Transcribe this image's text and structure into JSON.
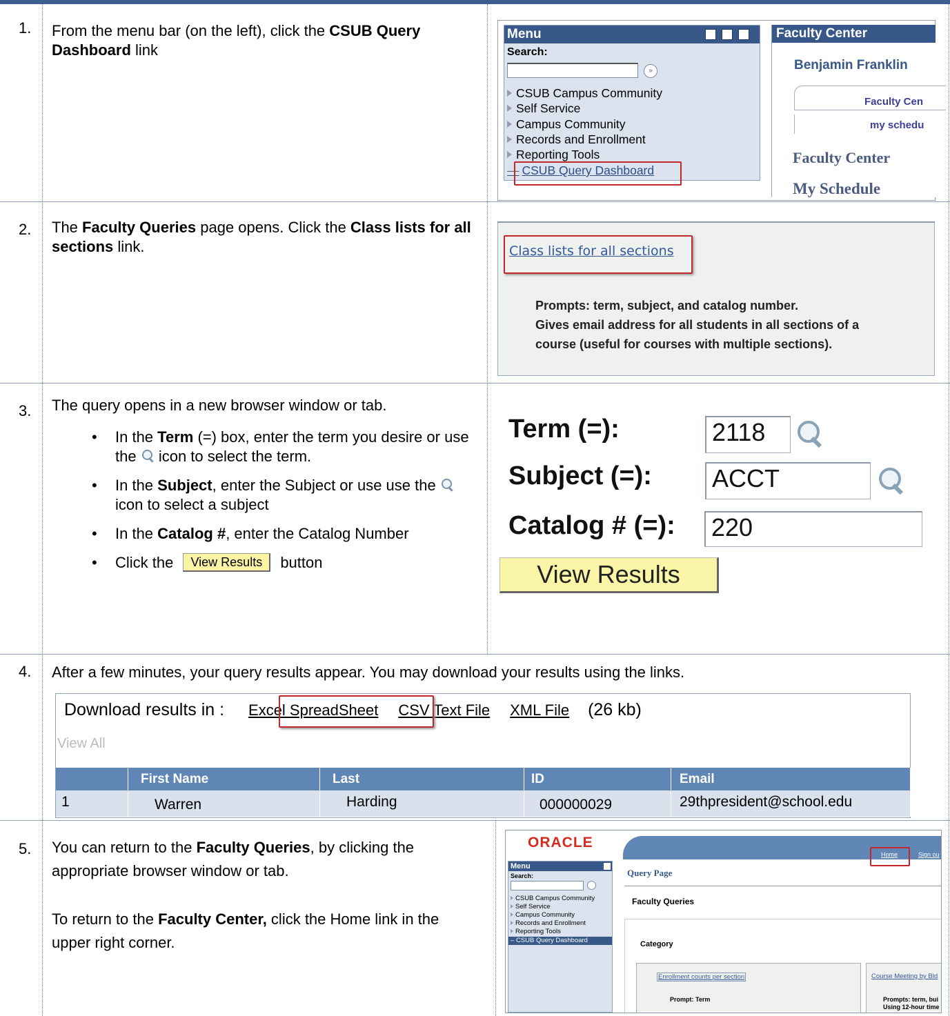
{
  "steps": [
    {
      "num": "1."
    },
    {
      "num": "2."
    },
    {
      "num": "3."
    },
    {
      "num": "4."
    },
    {
      "num": "5."
    }
  ],
  "step1": {
    "text_before": "From the menu bar (on the left), click the ",
    "bold": "CSUB Query Dashboard",
    "text_after": " link",
    "menu": {
      "title": "Menu",
      "search_label": "Search:",
      "items": [
        "CSUB Campus Community",
        "Self Service",
        "Campus Community",
        "Records and Enrollment",
        "Reporting Tools",
        "CSUB Query Dashboard"
      ]
    },
    "faculty": {
      "title": "Faculty Center",
      "name": "Benjamin Franklin",
      "tab1": "Faculty Cen",
      "tab2": "my schedu",
      "heading1": "Faculty Center",
      "heading2": "My Schedule"
    }
  },
  "step2": {
    "t1": "The ",
    "b1": "Faculty Queries",
    "t2": " page opens. Click the ",
    "b2": "Class lists for all sections",
    "t3": " link.",
    "link": "Class lists for all sections",
    "prompt1": "Prompts: term, subject, and catalog number.",
    "prompt2": "Gives email address for all students in all sections of a",
    "prompt3": "course (useful for courses with multiple sections)."
  },
  "step3": {
    "intro": "The query opens in a new browser window or tab.",
    "b1a": "In the ",
    "b1b": "Term",
    "b1c": " (=) box, enter the term you desire or use the ",
    "b1d": " icon to select the term.",
    "b2a": "In the ",
    "b2b": "Subject",
    "b2c": ", enter the Subject or use use the ",
    "b2d": " icon to select a subject",
    "b3a": "In the ",
    "b3b": "Catalog #",
    "b3c": ", enter the Catalog Number",
    "b4a": "Click the ",
    "b4btn": "View Results",
    "b4c": " button",
    "form": {
      "term_label": "Term (=):",
      "term_value": "2118",
      "subject_label": "Subject (=):",
      "subject_value": "ACCT",
      "catalog_label": "Catalog # (=):",
      "catalog_value": "220",
      "button": "View Results"
    }
  },
  "step4": {
    "text": "After a few minutes, your query results appear. You may download your results using the links.",
    "download_label": "Download results in :",
    "links": [
      "Excel SpreadSheet",
      "CSV Text File",
      "XML File"
    ],
    "size": "(26 kb)",
    "view_all": "View All",
    "columns": [
      "",
      "First Name",
      "Last",
      "ID",
      "Email"
    ],
    "row": [
      "1",
      "Warren",
      "Harding",
      "000000029",
      "29thpresident@school.edu"
    ]
  },
  "step5": {
    "t1": "You can return to the ",
    "b1": "Faculty Queries",
    "t2": ", by clicking the appropriate browser window or tab.",
    "t3": "To return to the ",
    "b2": "Faculty Center,",
    "t4": " click the Home link in the upper right corner.",
    "logo": "ORACLE",
    "home": "Home",
    "signout": "Sign ou",
    "menu_title": "Menu",
    "search_label": "Search:",
    "menu_items": [
      "CSUB Campus Community",
      "Self Service",
      "Campus Community",
      "Records and Enrollment",
      "Reporting Tools",
      "CSUB Query Dashboard"
    ],
    "page_title": "Query Page",
    "section": "Faculty Queries",
    "category": "Category",
    "link1": "Enrollment counts per section",
    "link2": "Course Meeting by Bld",
    "prompt1": "Prompt: Term",
    "prompt2a": "Prompts: term, bui",
    "prompt2b": "Using 12-hour time"
  }
}
